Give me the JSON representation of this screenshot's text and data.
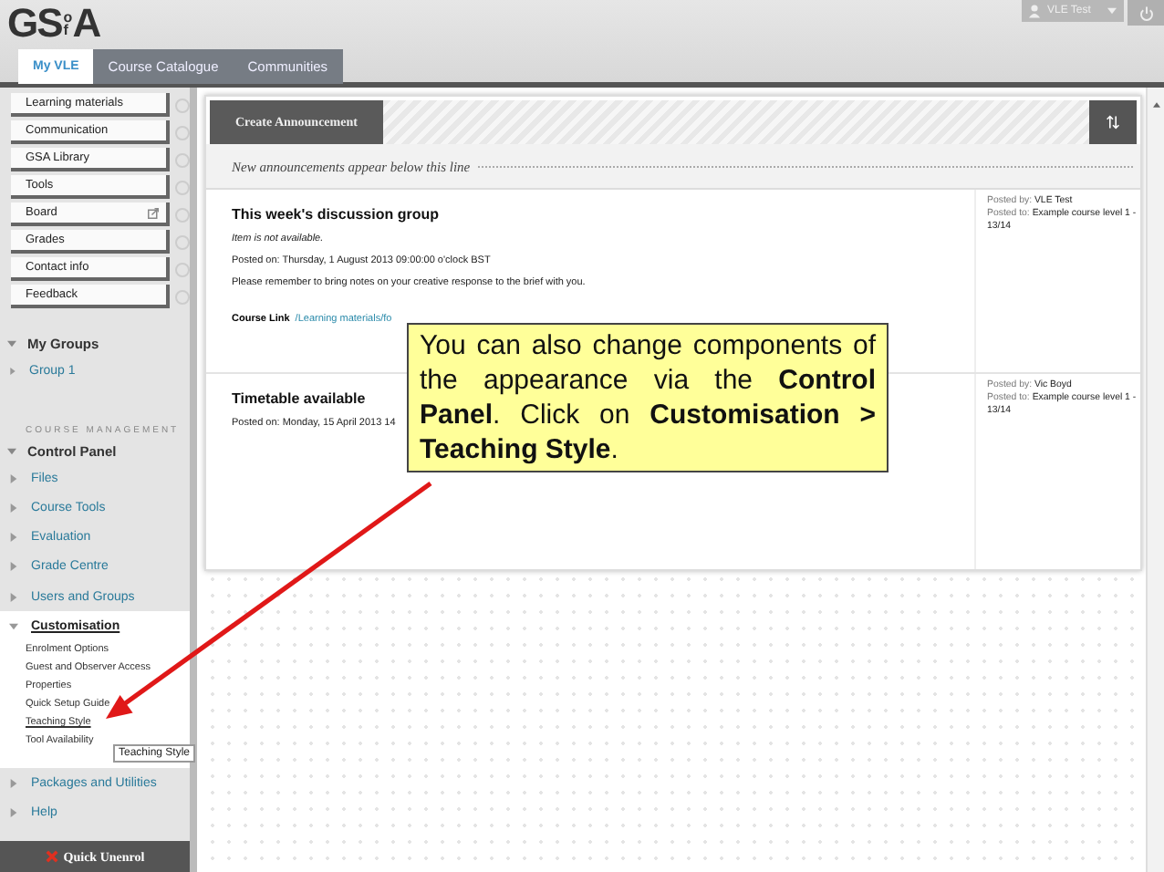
{
  "header": {
    "logo": {
      "left": "GS",
      "top": "o",
      "bottom": "f",
      "right": "A"
    },
    "user": "VLE Test",
    "tabs": [
      {
        "label": "My VLE",
        "selected": true
      },
      {
        "label": "Course Catalogue",
        "selected": false
      },
      {
        "label": "Communities",
        "selected": false
      }
    ]
  },
  "course_menu": [
    {
      "label": "Learning materials",
      "external": false
    },
    {
      "label": "Communication",
      "external": false
    },
    {
      "label": "GSA Library",
      "external": false
    },
    {
      "label": "Tools",
      "external": false
    },
    {
      "label": "Board",
      "external": true
    },
    {
      "label": "Grades",
      "external": false
    },
    {
      "label": "Contact info",
      "external": false
    },
    {
      "label": "Feedback",
      "external": false
    }
  ],
  "my_groups": {
    "title": "My Groups",
    "expanded": true,
    "items": [
      "Group 1"
    ]
  },
  "management": {
    "heading": "COURSE MANAGEMENT",
    "title": "Control Panel",
    "items": [
      {
        "label": "Files",
        "expanded": false
      },
      {
        "label": "Course Tools",
        "expanded": false
      },
      {
        "label": "Evaluation",
        "expanded": false
      },
      {
        "label": "Grade Centre",
        "expanded": false
      },
      {
        "label": "Users and Groups",
        "expanded": false
      },
      {
        "label": "Customisation",
        "expanded": true,
        "children": [
          {
            "label": "Enrolment Options",
            "selected": false
          },
          {
            "label": "Guest and Observer Access",
            "selected": false
          },
          {
            "label": "Properties",
            "selected": false
          },
          {
            "label": "Quick Setup Guide",
            "selected": false
          },
          {
            "label": "Teaching Style",
            "selected": true
          },
          {
            "label": "Tool Availability",
            "selected": false
          }
        ]
      },
      {
        "label": "Packages and Utilities",
        "expanded": false
      },
      {
        "label": "Help",
        "expanded": false
      }
    ],
    "tooltip": "Teaching Style",
    "unenrol": "Quick Unenrol"
  },
  "main": {
    "action": "Create Announcement",
    "divider": "New announcements appear below this line",
    "announcements": [
      {
        "title": "This week's discussion group",
        "availability": "Item is not available.",
        "posted_on": "Posted on: Thursday, 1 August 2013 09:00:00 o'clock BST",
        "body": "Please remember to bring notes on your creative response to the brief with you.",
        "link_label": "Course Link",
        "link": "/Learning materials/fo",
        "by_label": "Posted by:",
        "by": "VLE Test",
        "to_label": "Posted to:",
        "to": "Example course level 1 - 13/14"
      },
      {
        "title": "Timetable available",
        "posted_on": "Posted on: Monday, 15 April 2013 14",
        "by_label": "Posted by:",
        "by": "Vic Boyd",
        "to_label": "Posted to:",
        "to": "Example course level 1 - 13/14"
      }
    ]
  },
  "callout": "You can also change components of the appearance via the **Control Panel**. Click on **Customisation > Teaching Style**."
}
